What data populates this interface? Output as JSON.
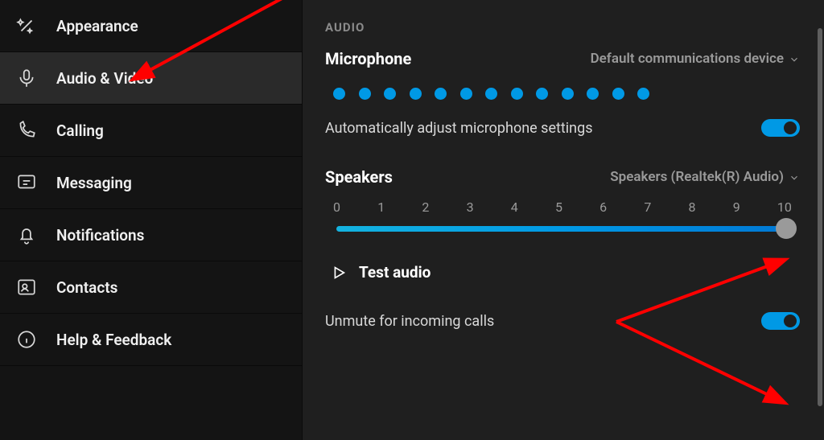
{
  "sidebar": {
    "items": [
      {
        "label": "Appearance"
      },
      {
        "label": "Audio & Video"
      },
      {
        "label": "Calling"
      },
      {
        "label": "Messaging"
      },
      {
        "label": "Notifications"
      },
      {
        "label": "Contacts"
      },
      {
        "label": "Help & Feedback"
      }
    ]
  },
  "main": {
    "section": "AUDIO",
    "microphone": {
      "label": "Microphone",
      "device": "Default communications device"
    },
    "auto_adjust": "Automatically adjust microphone settings",
    "speakers": {
      "label": "Speakers",
      "device": "Speakers (Realtek(R) Audio)",
      "ticks": [
        "0",
        "1",
        "2",
        "3",
        "4",
        "5",
        "6",
        "7",
        "8",
        "9",
        "10"
      ],
      "value": 10
    },
    "test_audio": "Test audio",
    "unmute": "Unmute for incoming calls"
  }
}
